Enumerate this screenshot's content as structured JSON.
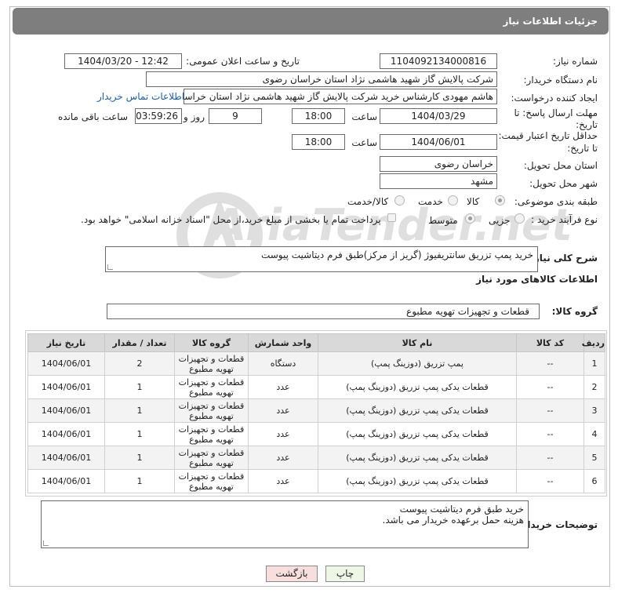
{
  "title": "جزئیات اطلاعات نیاز",
  "fields": {
    "need_number_label": "شماره نیاز:",
    "need_number": "1104092134000816",
    "announce_label": "تاریخ و ساعت اعلان عمومی:",
    "announce_value": "1404/03/20 - 12:42",
    "buyer_org_label": "نام دستگاه خریدار:",
    "buyer_org": "شرکت پالایش گاز شهید هاشمی نژاد   استان خراسان رضوی",
    "creator_label": "ایجاد کننده درخواست:",
    "creator": "هاشم مهودی کارشناس خرید شرکت پالایش گاز شهید هاشمی نژاد   استان خراسان رضوی",
    "contact_link": "اطلاعات تماس خریدار",
    "reply_deadline_label_1": "مهلت ارسال پاسخ: تا",
    "reply_deadline_label_2": "تاریخ:",
    "reply_date": "1404/03/29",
    "time_label": "ساعت",
    "reply_time": "18:00",
    "days_value": "9",
    "days_label": "روز و",
    "remaining_time": "03:59:26",
    "remaining_label": "ساعت باقی مانده",
    "price_deadline_label_1": "حداقل تاریخ اعتبار قیمت:",
    "price_deadline_label_2": "تا تاریخ:",
    "price_date": "1404/06/01",
    "price_time": "18:00",
    "province_label": "استان محل تحویل:",
    "province": "خراسان رضوی",
    "city_label": "شهر محل تحویل:",
    "city": "مشهد",
    "category_label": "طبقه بندی موضوعی:",
    "category_options": [
      "کالا",
      "خدمت",
      "کالا/خدمت"
    ],
    "process_label": "نوع فرآیند خرید :",
    "process_options": [
      "جزیی",
      "متوسط"
    ],
    "payment_note": "پرداخت تمام یا بخشی از مبلغ خرید،از محل \"اسناد خزانه اسلامی\" خواهد بود.",
    "summary_label": "شرح کلی نیاز:",
    "summary": "خرید پمپ تزریق سانتریفیوژ (گریز از مرکز)طبق فرم دیتاشیت پیوست",
    "goods_info_title": "اطلاعات کالاهای مورد نیاز",
    "goods_group_label": "گروه کالا:",
    "goods_group": "قطعات و تجهیزات تهویه مطبوع"
  },
  "table": {
    "headers": [
      "ردیف",
      "کد کالا",
      "نام کالا",
      "واحد شمارش",
      "گروه کالا",
      "تعداد / مقدار",
      "تاریخ نیاز"
    ],
    "rows": [
      [
        "1",
        "--",
        "پمپ تزریق (دوزینگ پمپ)",
        "دستگاه",
        "قطعات و تجهیزات تهویه مطبوع",
        "2",
        "1404/06/01"
      ],
      [
        "2",
        "--",
        "قطعات یدکی پمپ تزریق (دوزینگ پمپ)",
        "عدد",
        "قطعات و تجهیزات تهویه مطبوع",
        "1",
        "1404/06/01"
      ],
      [
        "3",
        "--",
        "قطعات یدکی پمپ تزریق (دوزینگ پمپ)",
        "عدد",
        "قطعات و تجهیزات تهویه مطبوع",
        "1",
        "1404/06/01"
      ],
      [
        "4",
        "--",
        "قطعات یدکی پمپ تزریق (دوزینگ پمپ)",
        "عدد",
        "قطعات و تجهیزات تهویه مطبوع",
        "1",
        "1404/06/01"
      ],
      [
        "5",
        "--",
        "قطعات یدکی پمپ تزریق (دوزینگ پمپ)",
        "عدد",
        "قطعات و تجهیزات تهویه مطبوع",
        "1",
        "1404/06/01"
      ],
      [
        "6",
        "--",
        "قطعات یدکی پمپ تزریق (دوزینگ پمپ)",
        "عدد",
        "قطعات و تجهیزات تهویه مطبوع",
        "1",
        "1404/06/01"
      ]
    ]
  },
  "buyer_notes_label": "توضیحات خریدار:",
  "buyer_notes_line1": "خرید طبق فرم دیتاشیت پیوست",
  "buyer_notes_line2": "هزینه حمل برعهده خریدار می باشد.",
  "buttons": {
    "print": "چاپ",
    "back": "بازگشت"
  },
  "watermark": "AriaTender.net"
}
